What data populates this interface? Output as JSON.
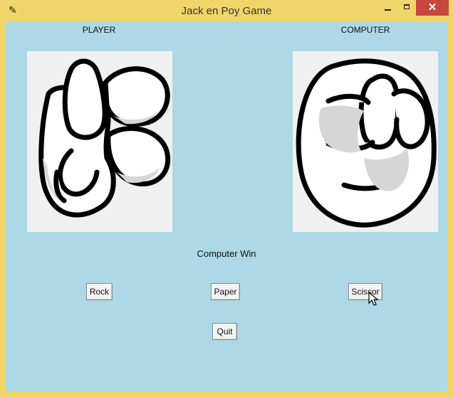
{
  "window": {
    "title": "Jack en Poy Game",
    "app_icon": "feather-icon",
    "close_glyph": "✕"
  },
  "labels": {
    "player": "PLAYER",
    "computer": "COMPUTER"
  },
  "hands": {
    "player": "scissors-hand-icon",
    "computer": "rock-fist-icon"
  },
  "result": "Computer Win",
  "buttons": {
    "rock": "Rock",
    "paper": "Paper",
    "scissor": "Scissor",
    "quit": "Quit"
  },
  "colors": {
    "background": "#add8e6",
    "frame": "#f0d56a",
    "close": "#c7483e"
  }
}
